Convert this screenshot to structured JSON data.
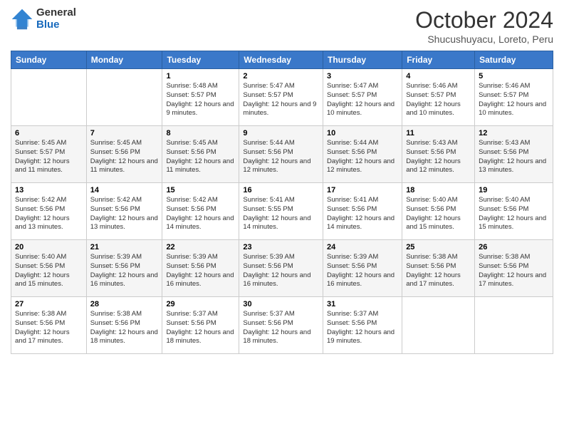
{
  "logo": {
    "general": "General",
    "blue": "Blue"
  },
  "header": {
    "month": "October 2024",
    "location": "Shucushuyacu, Loreto, Peru"
  },
  "weekdays": [
    "Sunday",
    "Monday",
    "Tuesday",
    "Wednesday",
    "Thursday",
    "Friday",
    "Saturday"
  ],
  "weeks": [
    [
      null,
      null,
      {
        "day": 1,
        "sunrise": "5:48 AM",
        "sunset": "5:57 PM",
        "daylight": "12 hours and 9 minutes."
      },
      {
        "day": 2,
        "sunrise": "5:47 AM",
        "sunset": "5:57 PM",
        "daylight": "12 hours and 9 minutes."
      },
      {
        "day": 3,
        "sunrise": "5:47 AM",
        "sunset": "5:57 PM",
        "daylight": "12 hours and 10 minutes."
      },
      {
        "day": 4,
        "sunrise": "5:46 AM",
        "sunset": "5:57 PM",
        "daylight": "12 hours and 10 minutes."
      },
      {
        "day": 5,
        "sunrise": "5:46 AM",
        "sunset": "5:57 PM",
        "daylight": "12 hours and 10 minutes."
      }
    ],
    [
      {
        "day": 6,
        "sunrise": "5:45 AM",
        "sunset": "5:57 PM",
        "daylight": "12 hours and 11 minutes."
      },
      {
        "day": 7,
        "sunrise": "5:45 AM",
        "sunset": "5:56 PM",
        "daylight": "12 hours and 11 minutes."
      },
      {
        "day": 8,
        "sunrise": "5:45 AM",
        "sunset": "5:56 PM",
        "daylight": "12 hours and 11 minutes."
      },
      {
        "day": 9,
        "sunrise": "5:44 AM",
        "sunset": "5:56 PM",
        "daylight": "12 hours and 12 minutes."
      },
      {
        "day": 10,
        "sunrise": "5:44 AM",
        "sunset": "5:56 PM",
        "daylight": "12 hours and 12 minutes."
      },
      {
        "day": 11,
        "sunrise": "5:43 AM",
        "sunset": "5:56 PM",
        "daylight": "12 hours and 12 minutes."
      },
      {
        "day": 12,
        "sunrise": "5:43 AM",
        "sunset": "5:56 PM",
        "daylight": "12 hours and 13 minutes."
      }
    ],
    [
      {
        "day": 13,
        "sunrise": "5:42 AM",
        "sunset": "5:56 PM",
        "daylight": "12 hours and 13 minutes."
      },
      {
        "day": 14,
        "sunrise": "5:42 AM",
        "sunset": "5:56 PM",
        "daylight": "12 hours and 13 minutes."
      },
      {
        "day": 15,
        "sunrise": "5:42 AM",
        "sunset": "5:56 PM",
        "daylight": "12 hours and 14 minutes."
      },
      {
        "day": 16,
        "sunrise": "5:41 AM",
        "sunset": "5:55 PM",
        "daylight": "12 hours and 14 minutes."
      },
      {
        "day": 17,
        "sunrise": "5:41 AM",
        "sunset": "5:56 PM",
        "daylight": "12 hours and 14 minutes."
      },
      {
        "day": 18,
        "sunrise": "5:40 AM",
        "sunset": "5:56 PM",
        "daylight": "12 hours and 15 minutes."
      },
      {
        "day": 19,
        "sunrise": "5:40 AM",
        "sunset": "5:56 PM",
        "daylight": "12 hours and 15 minutes."
      }
    ],
    [
      {
        "day": 20,
        "sunrise": "5:40 AM",
        "sunset": "5:56 PM",
        "daylight": "12 hours and 15 minutes."
      },
      {
        "day": 21,
        "sunrise": "5:39 AM",
        "sunset": "5:56 PM",
        "daylight": "12 hours and 16 minutes."
      },
      {
        "day": 22,
        "sunrise": "5:39 AM",
        "sunset": "5:56 PM",
        "daylight": "12 hours and 16 minutes."
      },
      {
        "day": 23,
        "sunrise": "5:39 AM",
        "sunset": "5:56 PM",
        "daylight": "12 hours and 16 minutes."
      },
      {
        "day": 24,
        "sunrise": "5:39 AM",
        "sunset": "5:56 PM",
        "daylight": "12 hours and 16 minutes."
      },
      {
        "day": 25,
        "sunrise": "5:38 AM",
        "sunset": "5:56 PM",
        "daylight": "12 hours and 17 minutes."
      },
      {
        "day": 26,
        "sunrise": "5:38 AM",
        "sunset": "5:56 PM",
        "daylight": "12 hours and 17 minutes."
      }
    ],
    [
      {
        "day": 27,
        "sunrise": "5:38 AM",
        "sunset": "5:56 PM",
        "daylight": "12 hours and 17 minutes."
      },
      {
        "day": 28,
        "sunrise": "5:38 AM",
        "sunset": "5:56 PM",
        "daylight": "12 hours and 18 minutes."
      },
      {
        "day": 29,
        "sunrise": "5:37 AM",
        "sunset": "5:56 PM",
        "daylight": "12 hours and 18 minutes."
      },
      {
        "day": 30,
        "sunrise": "5:37 AM",
        "sunset": "5:56 PM",
        "daylight": "12 hours and 18 minutes."
      },
      {
        "day": 31,
        "sunrise": "5:37 AM",
        "sunset": "5:56 PM",
        "daylight": "12 hours and 19 minutes."
      },
      null,
      null
    ]
  ],
  "labels": {
    "sunrise_prefix": "Sunrise: ",
    "sunset_prefix": "Sunset: ",
    "daylight_prefix": "Daylight: "
  }
}
